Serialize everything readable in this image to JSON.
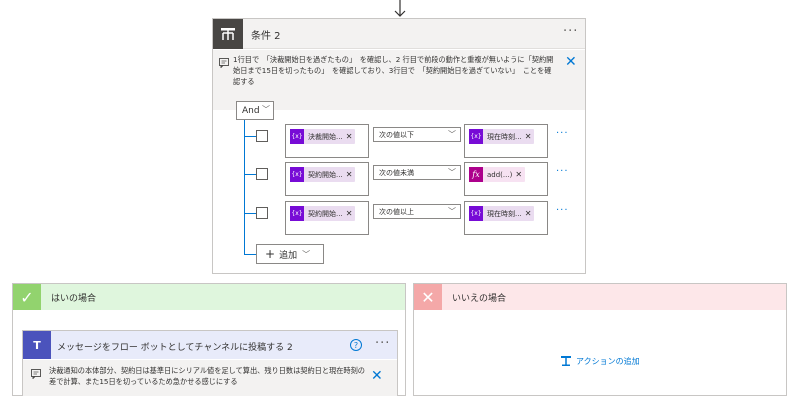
{
  "condition": {
    "title": "条件 2",
    "comment": "1行目で　「決裁開始日を過ぎたもの」　を確認し、2 行目で前段の動作と重複が無いように「契約開始日まで15日を切ったもの」　を確認しており、3行目で　「契約開始日を過ぎていない」　ことを確認する",
    "group_operator": "And",
    "rows": [
      {
        "left": "決裁開始...",
        "operator": "次の値以下",
        "right": "現在時刻...",
        "right_type": "variable"
      },
      {
        "left": "契約開始...",
        "operator": "次の値未満",
        "right": "add(...)",
        "right_type": "expression"
      },
      {
        "left": "契約開始...",
        "operator": "次の値以上",
        "right": "現在時刻...",
        "right_type": "variable"
      }
    ],
    "add_label": "追加"
  },
  "yes_branch": {
    "label": "はいの場合",
    "color": "#dff6dd",
    "icon_color": "#92d36e",
    "action": {
      "title": "メッセージをフロー ボットとしてチャンネルに投稿する 2",
      "comment": "決裁通知の本体部分、契約日は基準日にシリアル値を足して算出、残り日数は契約日と現在時刻の差で計算、また15日を切っているため急かせる感じにする",
      "icon_label": "T"
    }
  },
  "no_branch": {
    "label": "いいえの場合",
    "color": "#fde7e9",
    "icon_color": "#f4a8a8",
    "add_action_label": "アクションの追加"
  },
  "icons": {
    "condition": "condition-icon",
    "variable": "{x}",
    "expression": "fx",
    "more": "···",
    "close": "✕",
    "check": "✓"
  }
}
